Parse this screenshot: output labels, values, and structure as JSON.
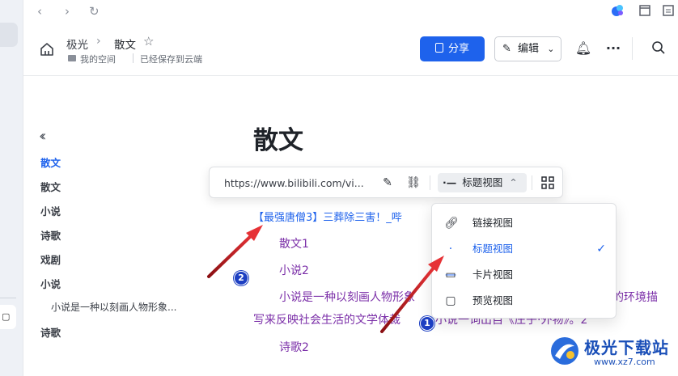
{
  "breadcrumb": {
    "parent": "极光",
    "current": "散文",
    "space": "我的空间",
    "save_status": "已经保存到云端"
  },
  "header_actions": {
    "share_label": "分享",
    "edit_label": "编辑"
  },
  "doc": {
    "title": "散文"
  },
  "toc": {
    "items": [
      {
        "label": "散文",
        "active": true
      },
      {
        "label": "散文"
      },
      {
        "label": "小说"
      },
      {
        "label": "诗歌"
      },
      {
        "label": "戏剧"
      },
      {
        "label": "小说"
      },
      {
        "label": "小说是一种以刻画人物形象...",
        "sub": true
      },
      {
        "label": "诗歌"
      }
    ]
  },
  "link_toolbar": {
    "url": "https://www.bilibili.com/vi...",
    "view_label": "标题视图"
  },
  "view_menu": {
    "items": [
      {
        "icon": "link-icon",
        "label": "链接视图"
      },
      {
        "icon": "title-view-icon",
        "label": "标题视图",
        "selected": true
      },
      {
        "icon": "card-view-icon",
        "label": "卡片视图"
      },
      {
        "icon": "preview-view-icon",
        "label": "预览视图"
      }
    ]
  },
  "content": {
    "link_text": "【最强唐僧3】三葬除三害！_哔",
    "lines": [
      "散文1",
      "小说2",
      "小说是一种以刻画人物形象",
      "的环境描",
      "写来反映社会生活的文学体裁",
      "小说一词出自《庄子·外物》。2",
      "诗歌2"
    ]
  },
  "annotations": {
    "badge1": "1",
    "badge2": "2"
  },
  "watermark": {
    "title": "极光下载站",
    "url": "www.xz7.com"
  },
  "colors": {
    "accent": "#1e62ec",
    "content_purple": "#7b2fa8",
    "arrow_red": "#d9262c"
  }
}
